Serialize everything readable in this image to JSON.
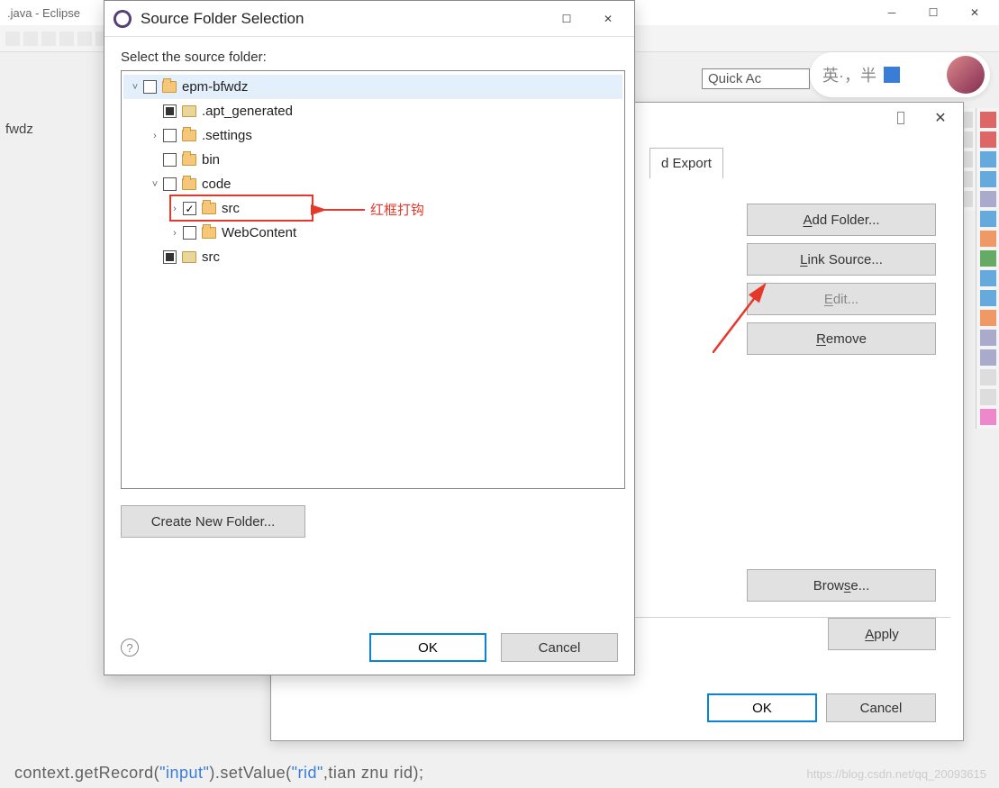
{
  "eclipse": {
    "title": ".java - Eclipse",
    "quick_access": "Quick Ac",
    "side_text": "fwdz"
  },
  "props": {
    "tab_snippet": "d Export",
    "buttons": {
      "add_folder": "Add Folder...",
      "link_source": "Link Source...",
      "edit": "Edit...",
      "remove": "Remove",
      "browse": "Browse...",
      "apply": "Apply",
      "ok": "OK",
      "cancel": "Cancel"
    }
  },
  "sfs": {
    "title": "Source Folder Selection",
    "label": "Select the source folder:",
    "tree": [
      {
        "depth": 0,
        "expander": "v",
        "check": "empty",
        "icon": "open",
        "label": "epm-bfwdz",
        "selected": true
      },
      {
        "depth": 1,
        "expander": "",
        "check": "filled",
        "icon": "pkg",
        "label": ".apt_generated"
      },
      {
        "depth": 1,
        "expander": ">",
        "check": "empty",
        "icon": "open",
        "label": ".settings"
      },
      {
        "depth": 1,
        "expander": "",
        "check": "empty",
        "icon": "open",
        "label": "bin"
      },
      {
        "depth": 1,
        "expander": "v",
        "check": "empty",
        "icon": "open",
        "label": "code"
      },
      {
        "depth": 2,
        "expander": ">",
        "check": "checked",
        "icon": "open",
        "label": "src",
        "redbox": true
      },
      {
        "depth": 2,
        "expander": ">",
        "check": "empty",
        "icon": "open",
        "label": "WebContent"
      },
      {
        "depth": 1,
        "expander": "",
        "check": "filled",
        "icon": "pkg",
        "label": "src"
      }
    ],
    "annotation": "红框打钩",
    "create_folder": "Create New Folder...",
    "ok": "OK",
    "cancel": "Cancel"
  },
  "badge": {
    "text1": "英·，半"
  },
  "code": {
    "p0": "context",
    "p1": ".getRecord(",
    "s1": "\"input\"",
    "p2": ").setValue(",
    "s2": "\"rid\"",
    "p3": ",tian znu rid);"
  },
  "watermark": "https://blog.csdn.net/qq_20093615"
}
